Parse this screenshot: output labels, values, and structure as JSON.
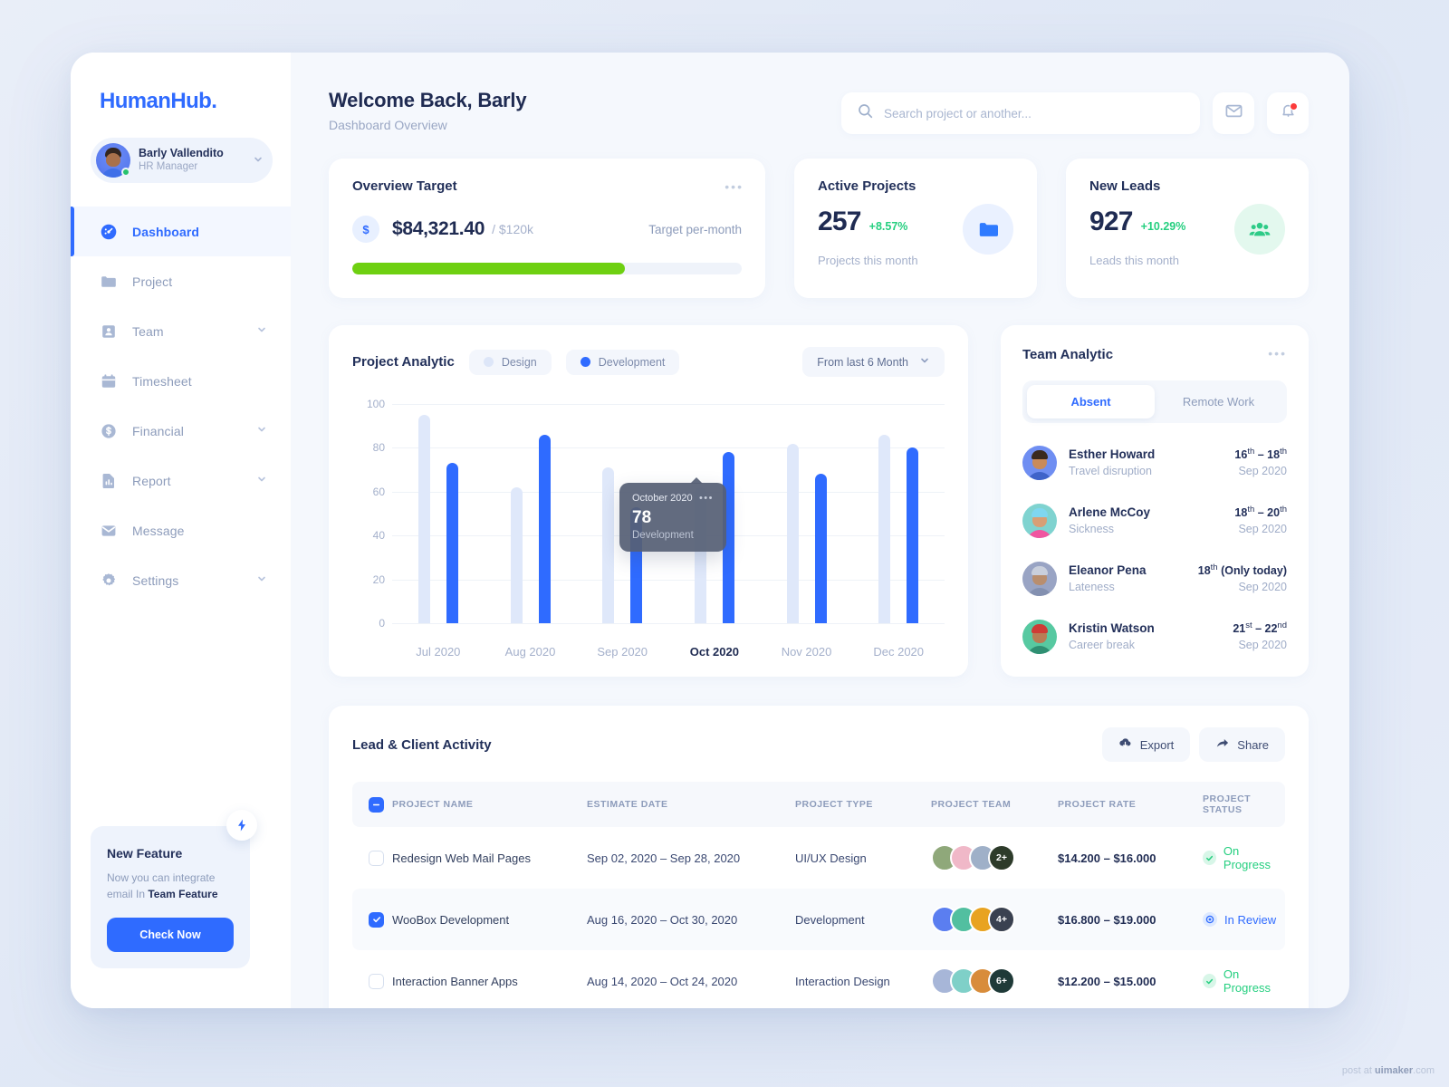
{
  "brand": {
    "name": "HumanHub."
  },
  "user": {
    "name": "Barly Vallendito",
    "role": "HR Manager"
  },
  "sidebar": {
    "items": [
      {
        "label": "Dashboard",
        "icon": "dashboard-icon",
        "active": true,
        "expandable": false
      },
      {
        "label": "Project",
        "icon": "folder-icon",
        "active": false,
        "expandable": false
      },
      {
        "label": "Team",
        "icon": "team-icon",
        "active": false,
        "expandable": true
      },
      {
        "label": "Timesheet",
        "icon": "calendar-icon",
        "active": false,
        "expandable": false
      },
      {
        "label": "Financial",
        "icon": "dollar-icon",
        "active": false,
        "expandable": true
      },
      {
        "label": "Report",
        "icon": "chart-icon",
        "active": false,
        "expandable": true
      },
      {
        "label": "Message",
        "icon": "mail-icon",
        "active": false,
        "expandable": false
      },
      {
        "label": "Settings",
        "icon": "gear-icon",
        "active": false,
        "expandable": true
      }
    ],
    "feature": {
      "title": "New Feature",
      "text_prefix": "Now you can integrate email In ",
      "text_bold": "Team Feature",
      "button": "Check Now",
      "icon": "bolt-icon"
    }
  },
  "header": {
    "title": "Welcome Back, Barly",
    "subtitle": "Dashboard Overview",
    "search_placeholder": "Search project or another...",
    "search_value": "",
    "mail_icon": "mail-icon",
    "bell_icon": "bell-icon"
  },
  "overview": {
    "title": "Overview Target",
    "currency_symbol": "$",
    "amount": "$84,321.40",
    "total": "/ $120k",
    "target_label": "Target per-month",
    "progress_percent": 70,
    "progress_color": "#6ed011",
    "menu": "•••"
  },
  "stats": [
    {
      "title": "Active Projects",
      "value": "257",
      "delta": "+8.57%",
      "caption": "Projects this month",
      "icon": "folder-icon",
      "accent": "#2f7bff"
    },
    {
      "title": "New Leads",
      "value": "927",
      "delta": "+10.29%",
      "caption": "Leads this month",
      "icon": "people-icon",
      "accent": "#2ecb87"
    }
  ],
  "analytic": {
    "title": "Project Analytic",
    "legend": [
      {
        "label": "Design",
        "color": "#dde6f8"
      },
      {
        "label": "Development",
        "color": "#2f6bff"
      }
    ],
    "range": "From last 6 Month",
    "range_icon": "chevron-down-icon",
    "tooltip": {
      "date": "October 2020",
      "value": "78",
      "category": "Development",
      "menu": "•••"
    }
  },
  "chart_data": {
    "type": "bar",
    "title": "Project Analytic",
    "categories": [
      "Jul 2020",
      "Aug 2020",
      "Sep 2020",
      "Oct 2020",
      "Nov 2020",
      "Dec 2020"
    ],
    "series": [
      {
        "name": "Design",
        "color": "#dfe8fa",
        "values": [
          95,
          62,
          71,
          62,
          82,
          86
        ]
      },
      {
        "name": "Development",
        "color": "#2f6bff",
        "values": [
          73,
          86,
          53,
          78,
          68,
          80
        ]
      }
    ],
    "xlabel": "",
    "ylabel": "",
    "ylim": [
      0,
      100
    ],
    "yticks": [
      0,
      20,
      40,
      60,
      80,
      100
    ],
    "grid": true,
    "legend_position": "top",
    "highlighted_category": "Oct 2020",
    "annotation": {
      "category": "Oct 2020",
      "series": "Development",
      "value": 78,
      "label": "October 2020"
    }
  },
  "team": {
    "title": "Team Analytic",
    "menu": "•••",
    "tabs": [
      {
        "label": "Absent",
        "active": true
      },
      {
        "label": "Remote Work",
        "active": false
      }
    ],
    "rows": [
      {
        "name": "Esther Howard",
        "reason": "Travel disruption",
        "range": "16th – 18th",
        "month": "Sep 2020",
        "av_bg": "#6f8ef2",
        "hair": "#3a2a20",
        "face": "#c98b5a",
        "body": "#3f63c9"
      },
      {
        "name": "Arlene McCoy",
        "reason": "Sickness",
        "range": "18th – 20th",
        "month": "Sep 2020",
        "av_bg": "#7fd3d0",
        "hair": "#7fd7f0",
        "face": "#d89f75",
        "body": "#f055a0"
      },
      {
        "name": "Eleanor Pena",
        "reason": "Lateness",
        "range": "18th (Only today)",
        "month": "Sep 2020",
        "av_bg": "#99a4c4",
        "hair": "#c9cfdc",
        "face": "#b98e6e",
        "body": "#8390b0"
      },
      {
        "name": "Kristin Watson",
        "reason": "Career break",
        "range": "21st – 22nd",
        "month": "Sep 2020",
        "av_bg": "#57c9a1",
        "hair": "#cf3b35",
        "face": "#b87c54",
        "body": "#2f8f72"
      }
    ]
  },
  "activity": {
    "title": "Lead & Client Activity",
    "export_label": "Export",
    "export_icon": "upload-cloud-icon",
    "share_label": "Share",
    "share_icon": "share-arrow-icon",
    "columns": [
      "PROJECT NAME",
      "ESTIMATE DATE",
      "PROJECT TYPE",
      "PROJECT TEAM",
      "PROJECT RATE",
      "PROJECT STATUS"
    ],
    "rows": [
      {
        "checked": false,
        "name": "Redesign Web Mail Pages",
        "date": "Sep 02, 2020 – Sep 28, 2020",
        "type": "UI/UX Design",
        "team_extra": "2+",
        "team_colors": [
          "#8fa87a",
          "#f0b8c8",
          "#9fb0c8",
          "#2d3b2a"
        ],
        "rate": "$14.200 – $16.000",
        "status": "On Progress",
        "status_kind": "prog"
      },
      {
        "checked": true,
        "name": "WooBox Development",
        "date": "Aug 16, 2020 – Oct 30, 2020",
        "type": "Development",
        "team_extra": "4+",
        "team_colors": [
          "#5b7ef0",
          "#52bfa0",
          "#e8a321",
          "#3a4150"
        ],
        "rate": "$16.800 – $19.000",
        "status": "In Review",
        "status_kind": "rev"
      },
      {
        "checked": false,
        "name": "Interaction Banner Apps",
        "date": "Aug 14, 2020 – Oct 24, 2020",
        "type": "Interaction Design",
        "team_extra": "6+",
        "team_colors": [
          "#a7b6d8",
          "#7fd0c8",
          "#d88c3a",
          "#1f3a38"
        ],
        "rate": "$12.200 – $15.000",
        "status": "On Progress",
        "status_kind": "prog"
      }
    ]
  },
  "watermark": {
    "prefix": "post at ",
    "bold": "uimaker",
    "suffix": ".com"
  }
}
